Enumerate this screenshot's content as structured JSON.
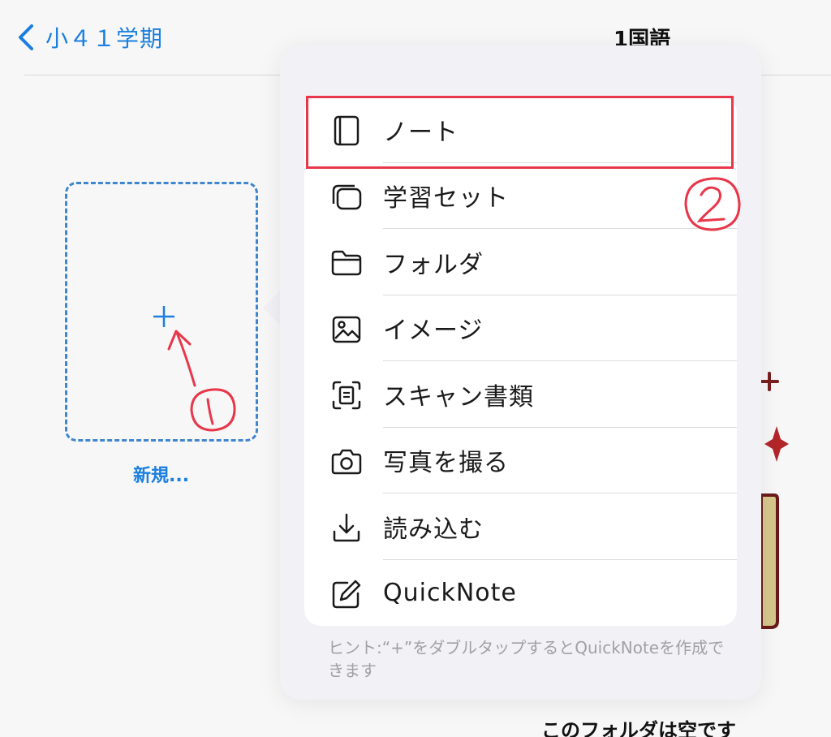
{
  "header": {
    "back_label": "小４１学期",
    "title": "1国語"
  },
  "new_tile": {
    "label": "新規..."
  },
  "menu": {
    "items": [
      {
        "label": "ノート",
        "icon": "notebook-icon"
      },
      {
        "label": "学習セット",
        "icon": "study-set-icon"
      },
      {
        "label": "フォルダ",
        "icon": "folder-icon"
      },
      {
        "label": "イメージ",
        "icon": "image-icon"
      },
      {
        "label": "スキャン書類",
        "icon": "scan-document-icon"
      },
      {
        "label": "写真を撮る",
        "icon": "camera-icon"
      },
      {
        "label": "読み込む",
        "icon": "import-icon"
      },
      {
        "label": "QuickNote",
        "icon": "quicknote-icon"
      }
    ],
    "hint": "ヒント:“+”をダブルタップするとQuickNoteを作成できます"
  },
  "empty_folder_text": "このフォルダは空です",
  "colors": {
    "accent": "#1a7fe0",
    "annotation": "#e8374a"
  }
}
